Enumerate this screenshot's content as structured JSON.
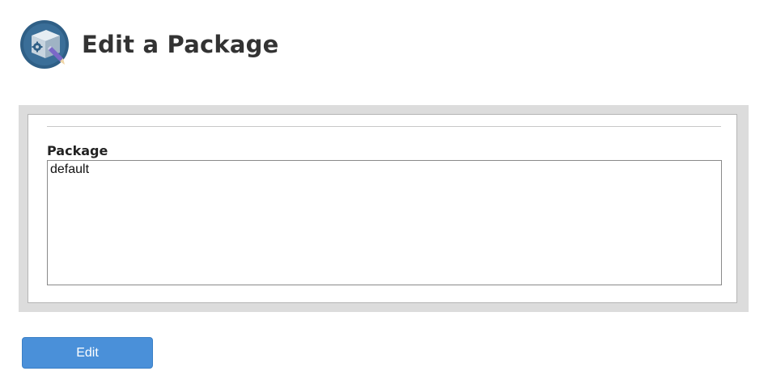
{
  "header": {
    "title": "Edit a Package",
    "icon": "package-gear-icon"
  },
  "form": {
    "field_label": "Package",
    "options": [
      "default"
    ],
    "selected": "default"
  },
  "actions": {
    "edit_label": "Edit"
  },
  "colors": {
    "button": "#4a90d9",
    "panel_border": "#dcdcdc",
    "icon_circle": "#2f5f86"
  }
}
